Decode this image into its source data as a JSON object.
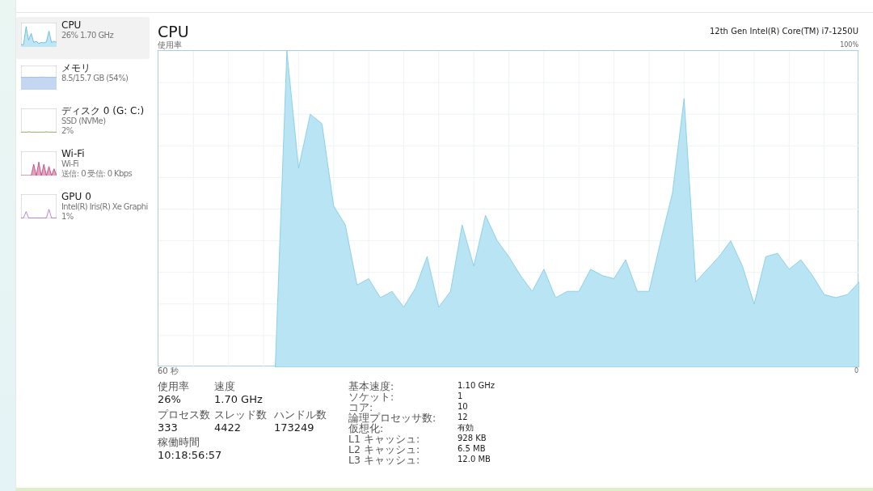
{
  "sidebar": {
    "items": [
      {
        "kind": "cpu",
        "title": "CPU",
        "lines": [
          "26% 1.70 GHz"
        ],
        "selected": true
      },
      {
        "kind": "memory",
        "title": "メモリ",
        "lines": [
          "8.5/15.7 GB (54%)"
        ],
        "selected": false
      },
      {
        "kind": "disk",
        "title": "ディスク 0 (G: C:)",
        "lines": [
          "SSD (NVMe)",
          "2%"
        ],
        "selected": false
      },
      {
        "kind": "wifi",
        "title": "Wi-Fi",
        "lines": [
          "Wi-Fi",
          "送信: 0 受信: 0 Kbps"
        ],
        "selected": false
      },
      {
        "kind": "gpu",
        "title": "GPU 0",
        "lines": [
          "Intel(R) Iris(R) Xe Graphi",
          "1%"
        ],
        "selected": false
      }
    ]
  },
  "header": {
    "title": "CPU",
    "model": "12th Gen Intel(R) Core(TM) i7-1250U"
  },
  "graph": {
    "ylabel": "使用率",
    "ymax_label": "100%",
    "xstart_label": "60 秒",
    "xend_label": "0"
  },
  "stats": [
    {
      "label": "使用率",
      "value": "26%"
    },
    {
      "label": "速度",
      "value": "1.70 GHz"
    },
    {
      "label": "プロセス数",
      "value": "333"
    },
    {
      "label": "スレッド数",
      "value": "4422"
    },
    {
      "label": "ハンドル数",
      "value": "173249"
    },
    {
      "label": "稼働時間",
      "value": "10:18:56:57"
    }
  ],
  "specs": [
    {
      "label": "基本速度:",
      "value": "1.10 GHz"
    },
    {
      "label": "ソケット:",
      "value": "1"
    },
    {
      "label": "コア:",
      "value": "10"
    },
    {
      "label": "論理プロセッサ数:",
      "value": "12"
    },
    {
      "label": "仮想化:",
      "value": "有効"
    },
    {
      "label": "L1 キャッシュ:",
      "value": "928 KB"
    },
    {
      "label": "L2 キャッシュ:",
      "value": "6.5 MB"
    },
    {
      "label": "L3 キャッシュ:",
      "value": "12.0 MB"
    }
  ]
}
